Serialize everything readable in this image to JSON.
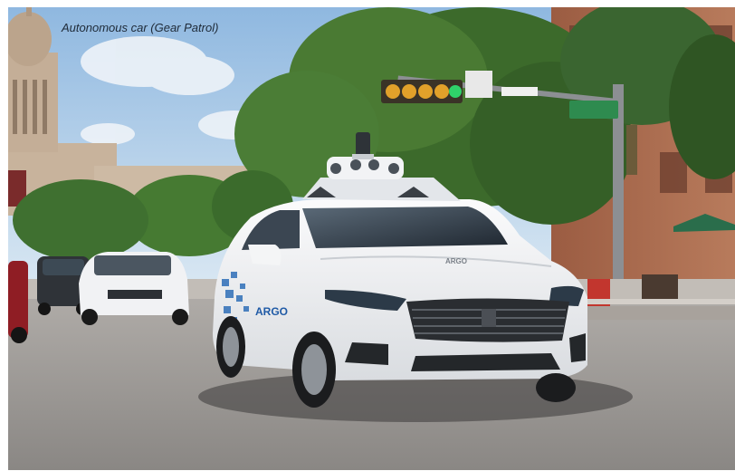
{
  "caption": "Autonomous car (Gear Patrol)",
  "photo": {
    "subject": "white-sedan-with-rooftop-sensor-array",
    "car_side_text": "ARGO",
    "hood_text": "ARGO",
    "colors": {
      "sky": "#a9c8e6",
      "foliage": "#3f6a2c",
      "road": "#9e9b98",
      "car_body": "#eef0f2",
      "car_shadow": "#2f3136",
      "brick": "#a86a4e",
      "capitol": "#c9b7a2",
      "street_sign": "#2e8b4f"
    }
  }
}
